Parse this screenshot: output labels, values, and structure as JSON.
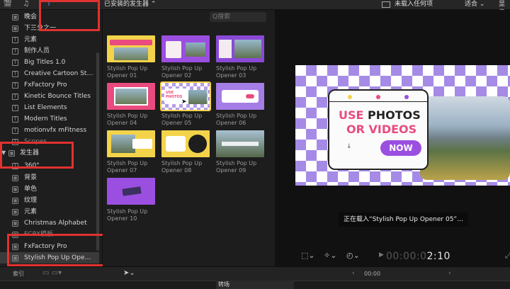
{
  "topbar": {
    "library_title": "已安装的发生器 ⌃",
    "viewer_title": "未载入任何项",
    "fit_label": "适合 ⌄",
    "display_label": "显示"
  },
  "sidebar": {
    "items": [
      {
        "label": "晚会",
        "icon": "film-icon"
      },
      {
        "label": "下三分之一",
        "icon": "film-icon"
      },
      {
        "label": "元素",
        "icon": "title-icon"
      },
      {
        "label": "制作人员",
        "icon": "title-icon"
      },
      {
        "label": "Big Titles 1.0",
        "icon": "title-icon"
      },
      {
        "label": "Creative Cartoon St…",
        "icon": "title-icon"
      },
      {
        "label": "FxFactory Pro",
        "icon": "title-icon"
      },
      {
        "label": "Kinetic Bounce Titles",
        "icon": "title-icon"
      },
      {
        "label": "List Elements",
        "icon": "title-icon"
      },
      {
        "label": "Modern Titles",
        "icon": "title-icon"
      },
      {
        "label": "motionvfx mFitness",
        "icon": "title-icon"
      },
      {
        "label": "Scopes",
        "icon": "title-icon"
      }
    ],
    "section": {
      "label": "发生器",
      "icon": "film-icon"
    },
    "gen_items": [
      {
        "label": "360°",
        "icon": "title-icon"
      },
      {
        "label": "背景",
        "icon": "film-icon"
      },
      {
        "label": "单色",
        "icon": "film-icon"
      },
      {
        "label": "纹理",
        "icon": "film-icon"
      },
      {
        "label": "元素",
        "icon": "film-icon"
      },
      {
        "label": "Christmas Alphabet",
        "icon": "film-icon"
      },
      {
        "label": "FCPX模板",
        "icon": "film-icon"
      },
      {
        "label": "FxFactory Pro",
        "icon": "film-icon"
      },
      {
        "label": "Stylish Pop Up Ope…",
        "icon": "film-icon"
      }
    ]
  },
  "browser": {
    "search_placeholder": "Q搜索",
    "clips": [
      {
        "name": "Stylish Pop Up Opener 01"
      },
      {
        "name": "Stylish Pop Up Opener 02"
      },
      {
        "name": "Stylish Pop Up Opener 03"
      },
      {
        "name": "Stylish Pop Up Opener 04"
      },
      {
        "name": "Stylish Pop Up Opener 05"
      },
      {
        "name": "Stylish Pop Up Opener 06"
      },
      {
        "name": "Stylish Pop Up Opener 07"
      },
      {
        "name": "Stylish Pop Up Opener 08"
      },
      {
        "name": "Stylish Pop Up Opener 09"
      },
      {
        "name": "Stylish Pop Up Opener 10"
      }
    ]
  },
  "viewer": {
    "preview_line1a": "USE ",
    "preview_line1b": "PHOTOS",
    "preview_line2": "OR VIDEOS",
    "preview_button": "NOW",
    "loading_text": "正在载入“Stylish Pop Up Opener 05”…",
    "timecode_dim": "00:00:0",
    "timecode_hi": "2:10"
  },
  "bottombar": {
    "index_label": "索引",
    "time_label": "00:00",
    "transition_label": "转场"
  },
  "colors": {
    "accent_red": "#e0322f",
    "purple": "#9b4fe0",
    "pink": "#e94b7e",
    "yellow_selection": "#f3d34a"
  }
}
